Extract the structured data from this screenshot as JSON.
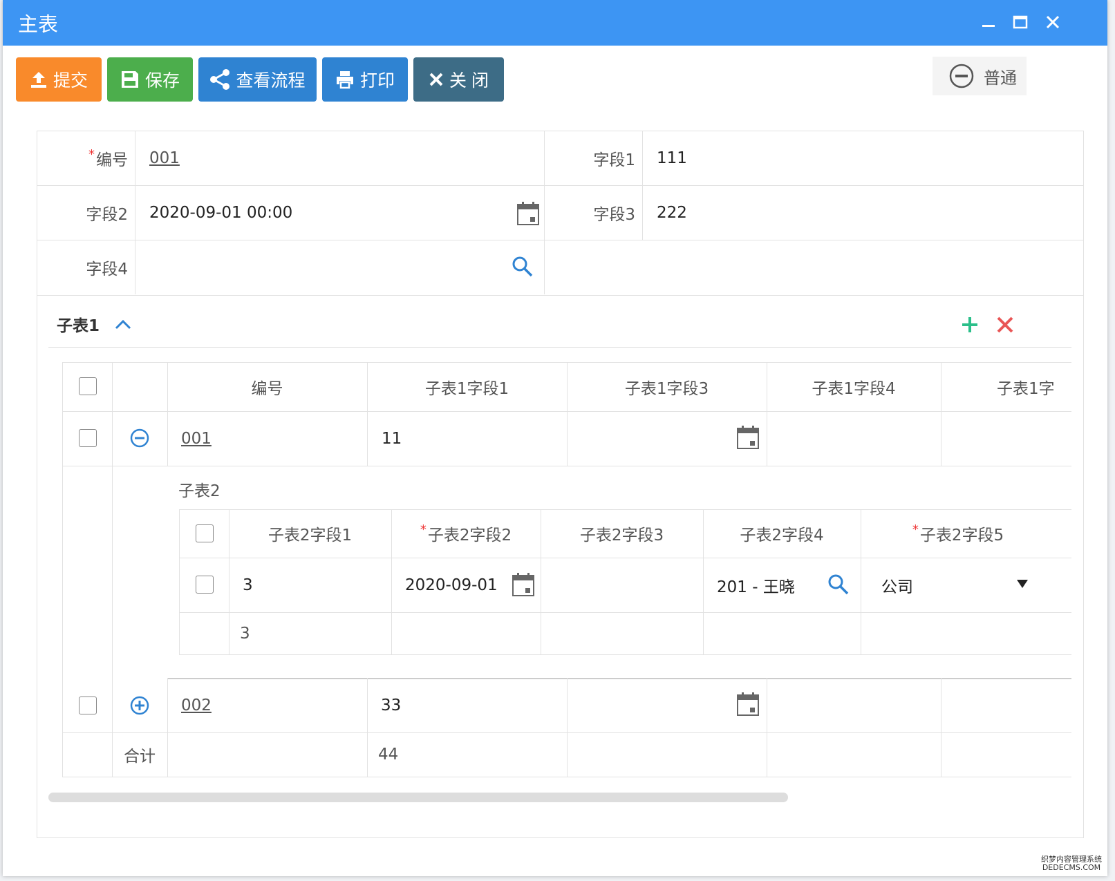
{
  "window": {
    "title": "主表"
  },
  "toolbar": {
    "submit": "提交",
    "save": "保存",
    "flow": "查看流程",
    "print": "打印",
    "close": "关 闭",
    "colors": {
      "submit": "#f98a2b",
      "save": "#4cae4c",
      "flow": "#2f83d2",
      "print": "#2f83d2",
      "close": "#3d6c86"
    }
  },
  "mode": {
    "label": "普通"
  },
  "form": {
    "no_label": "编号",
    "no_value": "001",
    "f1_label": "字段1",
    "f1_value": "111",
    "f2_label": "字段2",
    "f2_value": "2020-09-01 00:00",
    "f3_label": "字段3",
    "f3_value": "222",
    "f4_label": "字段4",
    "f4_value": ""
  },
  "sub1": {
    "title": "子表1",
    "headers": [
      "编号",
      "子表1字段1",
      "子表1字段3",
      "子表1字段4",
      "子表1字"
    ],
    "rows": [
      {
        "no": "001",
        "f1": "11"
      },
      {
        "no": "002",
        "f1": "33"
      }
    ],
    "total_label": "合计",
    "total_value": "44"
  },
  "sub2": {
    "title": "子表2",
    "headers": [
      "子表2字段1",
      "子表2字段2",
      "子表2字段3",
      "子表2字段4",
      "子表2字段5"
    ],
    "row": {
      "f1": "3",
      "f2": "2020-09-01",
      "f3": "",
      "f4": "201 - 王晓",
      "f5": "公司"
    },
    "total_f1": "3"
  },
  "watermark": {
    "line1": "织梦内容管理系统",
    "line2": "DEDECMS.COM"
  }
}
